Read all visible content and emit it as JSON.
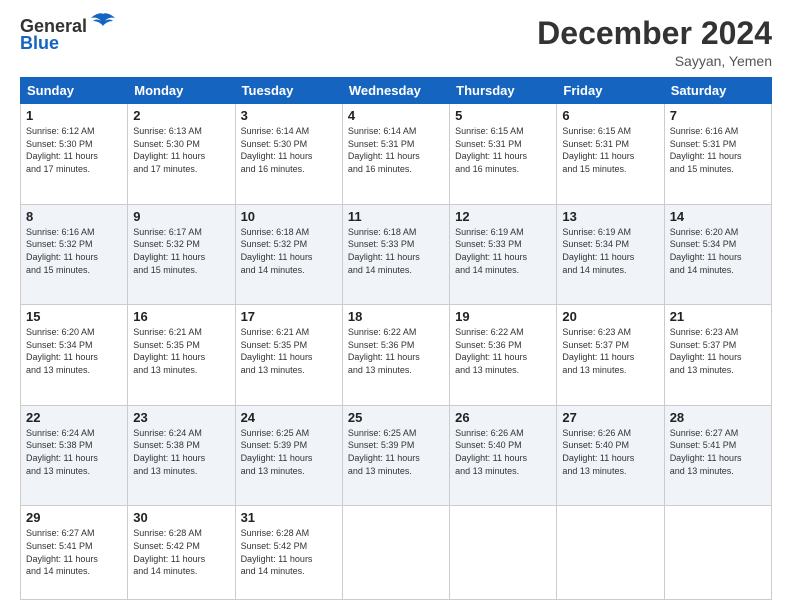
{
  "header": {
    "logo": {
      "line1": "General",
      "line2": "Blue"
    },
    "title": "December 2024",
    "location": "Sayyan, Yemen"
  },
  "weekdays": [
    "Sunday",
    "Monday",
    "Tuesday",
    "Wednesday",
    "Thursday",
    "Friday",
    "Saturday"
  ],
  "weeks": [
    [
      {
        "day": "1",
        "sunrise": "6:12 AM",
        "sunset": "5:30 PM",
        "daylight": "11 hours and 17 minutes."
      },
      {
        "day": "2",
        "sunrise": "6:13 AM",
        "sunset": "5:30 PM",
        "daylight": "11 hours and 17 minutes."
      },
      {
        "day": "3",
        "sunrise": "6:14 AM",
        "sunset": "5:30 PM",
        "daylight": "11 hours and 16 minutes."
      },
      {
        "day": "4",
        "sunrise": "6:14 AM",
        "sunset": "5:31 PM",
        "daylight": "11 hours and 16 minutes."
      },
      {
        "day": "5",
        "sunrise": "6:15 AM",
        "sunset": "5:31 PM",
        "daylight": "11 hours and 16 minutes."
      },
      {
        "day": "6",
        "sunrise": "6:15 AM",
        "sunset": "5:31 PM",
        "daylight": "11 hours and 15 minutes."
      },
      {
        "day": "7",
        "sunrise": "6:16 AM",
        "sunset": "5:31 PM",
        "daylight": "11 hours and 15 minutes."
      }
    ],
    [
      {
        "day": "8",
        "sunrise": "6:16 AM",
        "sunset": "5:32 PM",
        "daylight": "11 hours and 15 minutes."
      },
      {
        "day": "9",
        "sunrise": "6:17 AM",
        "sunset": "5:32 PM",
        "daylight": "11 hours and 15 minutes."
      },
      {
        "day": "10",
        "sunrise": "6:18 AM",
        "sunset": "5:32 PM",
        "daylight": "11 hours and 14 minutes."
      },
      {
        "day": "11",
        "sunrise": "6:18 AM",
        "sunset": "5:33 PM",
        "daylight": "11 hours and 14 minutes."
      },
      {
        "day": "12",
        "sunrise": "6:19 AM",
        "sunset": "5:33 PM",
        "daylight": "11 hours and 14 minutes."
      },
      {
        "day": "13",
        "sunrise": "6:19 AM",
        "sunset": "5:34 PM",
        "daylight": "11 hours and 14 minutes."
      },
      {
        "day": "14",
        "sunrise": "6:20 AM",
        "sunset": "5:34 PM",
        "daylight": "11 hours and 14 minutes."
      }
    ],
    [
      {
        "day": "15",
        "sunrise": "6:20 AM",
        "sunset": "5:34 PM",
        "daylight": "11 hours and 13 minutes."
      },
      {
        "day": "16",
        "sunrise": "6:21 AM",
        "sunset": "5:35 PM",
        "daylight": "11 hours and 13 minutes."
      },
      {
        "day": "17",
        "sunrise": "6:21 AM",
        "sunset": "5:35 PM",
        "daylight": "11 hours and 13 minutes."
      },
      {
        "day": "18",
        "sunrise": "6:22 AM",
        "sunset": "5:36 PM",
        "daylight": "11 hours and 13 minutes."
      },
      {
        "day": "19",
        "sunrise": "6:22 AM",
        "sunset": "5:36 PM",
        "daylight": "11 hours and 13 minutes."
      },
      {
        "day": "20",
        "sunrise": "6:23 AM",
        "sunset": "5:37 PM",
        "daylight": "11 hours and 13 minutes."
      },
      {
        "day": "21",
        "sunrise": "6:23 AM",
        "sunset": "5:37 PM",
        "daylight": "11 hours and 13 minutes."
      }
    ],
    [
      {
        "day": "22",
        "sunrise": "6:24 AM",
        "sunset": "5:38 PM",
        "daylight": "11 hours and 13 minutes."
      },
      {
        "day": "23",
        "sunrise": "6:24 AM",
        "sunset": "5:38 PM",
        "daylight": "11 hours and 13 minutes."
      },
      {
        "day": "24",
        "sunrise": "6:25 AM",
        "sunset": "5:39 PM",
        "daylight": "11 hours and 13 minutes."
      },
      {
        "day": "25",
        "sunrise": "6:25 AM",
        "sunset": "5:39 PM",
        "daylight": "11 hours and 13 minutes."
      },
      {
        "day": "26",
        "sunrise": "6:26 AM",
        "sunset": "5:40 PM",
        "daylight": "11 hours and 13 minutes."
      },
      {
        "day": "27",
        "sunrise": "6:26 AM",
        "sunset": "5:40 PM",
        "daylight": "11 hours and 13 minutes."
      },
      {
        "day": "28",
        "sunrise": "6:27 AM",
        "sunset": "5:41 PM",
        "daylight": "11 hours and 13 minutes."
      }
    ],
    [
      {
        "day": "29",
        "sunrise": "6:27 AM",
        "sunset": "5:41 PM",
        "daylight": "11 hours and 14 minutes."
      },
      {
        "day": "30",
        "sunrise": "6:28 AM",
        "sunset": "5:42 PM",
        "daylight": "11 hours and 14 minutes."
      },
      {
        "day": "31",
        "sunrise": "6:28 AM",
        "sunset": "5:42 PM",
        "daylight": "11 hours and 14 minutes."
      },
      null,
      null,
      null,
      null
    ]
  ]
}
